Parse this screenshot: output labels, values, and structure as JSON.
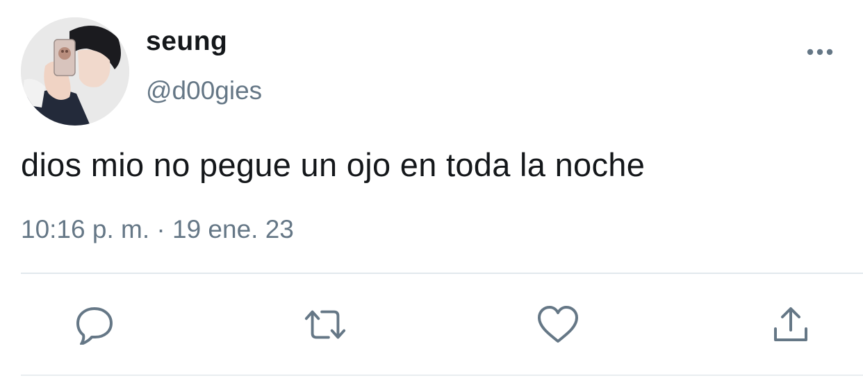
{
  "tweet": {
    "author": {
      "display_name": "seung",
      "handle": "@d00gies"
    },
    "text": "dios mio no pegue un ojo en toda la noche",
    "timestamp": "10:16 p. m. · 19 ene. 23"
  },
  "icons": {
    "more": "more-horizontal-icon",
    "reply": "reply-bubble-icon",
    "retweet": "retweet-icon",
    "like": "heart-icon",
    "share": "share-upload-icon"
  },
  "colors": {
    "text_primary": "#14171a",
    "text_secondary": "#657786",
    "icon": "#657786",
    "divider": "#e1e8ed"
  }
}
